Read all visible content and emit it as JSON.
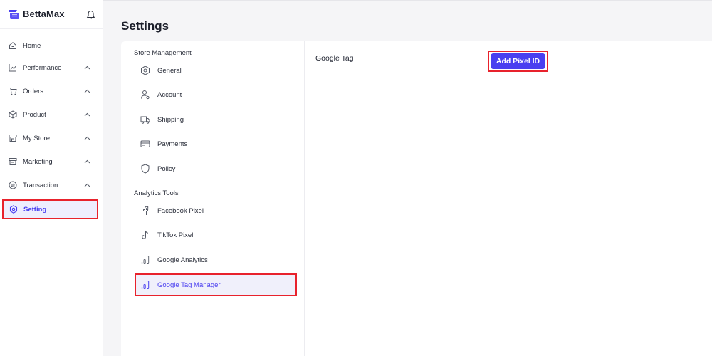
{
  "brand": {
    "name": "BettaMax",
    "logo_icon": "bettamax-logo-icon",
    "notification_icon": "bell-icon"
  },
  "accent_color": "#4a3ff0",
  "highlight_color": "#e8222c",
  "sidebar": {
    "items": [
      {
        "label": "Home",
        "icon": "home-icon",
        "expandable": false
      },
      {
        "label": "Performance",
        "icon": "chart-icon",
        "expandable": true
      },
      {
        "label": "Orders",
        "icon": "cart-icon",
        "expandable": true
      },
      {
        "label": "Product",
        "icon": "box-icon",
        "expandable": true
      },
      {
        "label": "My Store",
        "icon": "store-icon",
        "expandable": true
      },
      {
        "label": "Marketing",
        "icon": "marketing-icon",
        "expandable": true
      },
      {
        "label": "Transaction",
        "icon": "transaction-icon",
        "expandable": true
      },
      {
        "label": "Setting",
        "icon": "settings-icon",
        "expandable": false,
        "active": true
      }
    ]
  },
  "page": {
    "title": "Settings"
  },
  "settings_menu": {
    "store_management": {
      "title": "Store Management",
      "items": [
        {
          "label": "General",
          "icon": "hexagon-gear-icon"
        },
        {
          "label": "Account",
          "icon": "user-gear-icon"
        },
        {
          "label": "Shipping",
          "icon": "truck-icon"
        },
        {
          "label": "Payments",
          "icon": "credit-card-icon"
        },
        {
          "label": "Policy",
          "icon": "shield-icon"
        }
      ]
    },
    "analytics_tools": {
      "title": "Analytics Tools",
      "items": [
        {
          "label": "Facebook Pixel",
          "icon": "facebook-icon"
        },
        {
          "label": "TikTok Pixel",
          "icon": "tiktok-icon"
        },
        {
          "label": "Google Analytics",
          "icon": "analytics-bars-icon"
        },
        {
          "label": "Google Tag Manager",
          "icon": "analytics-bars-icon",
          "active": true
        }
      ]
    }
  },
  "content": {
    "label": "Google Tag",
    "add_button_label": "Add Pixel ID"
  }
}
